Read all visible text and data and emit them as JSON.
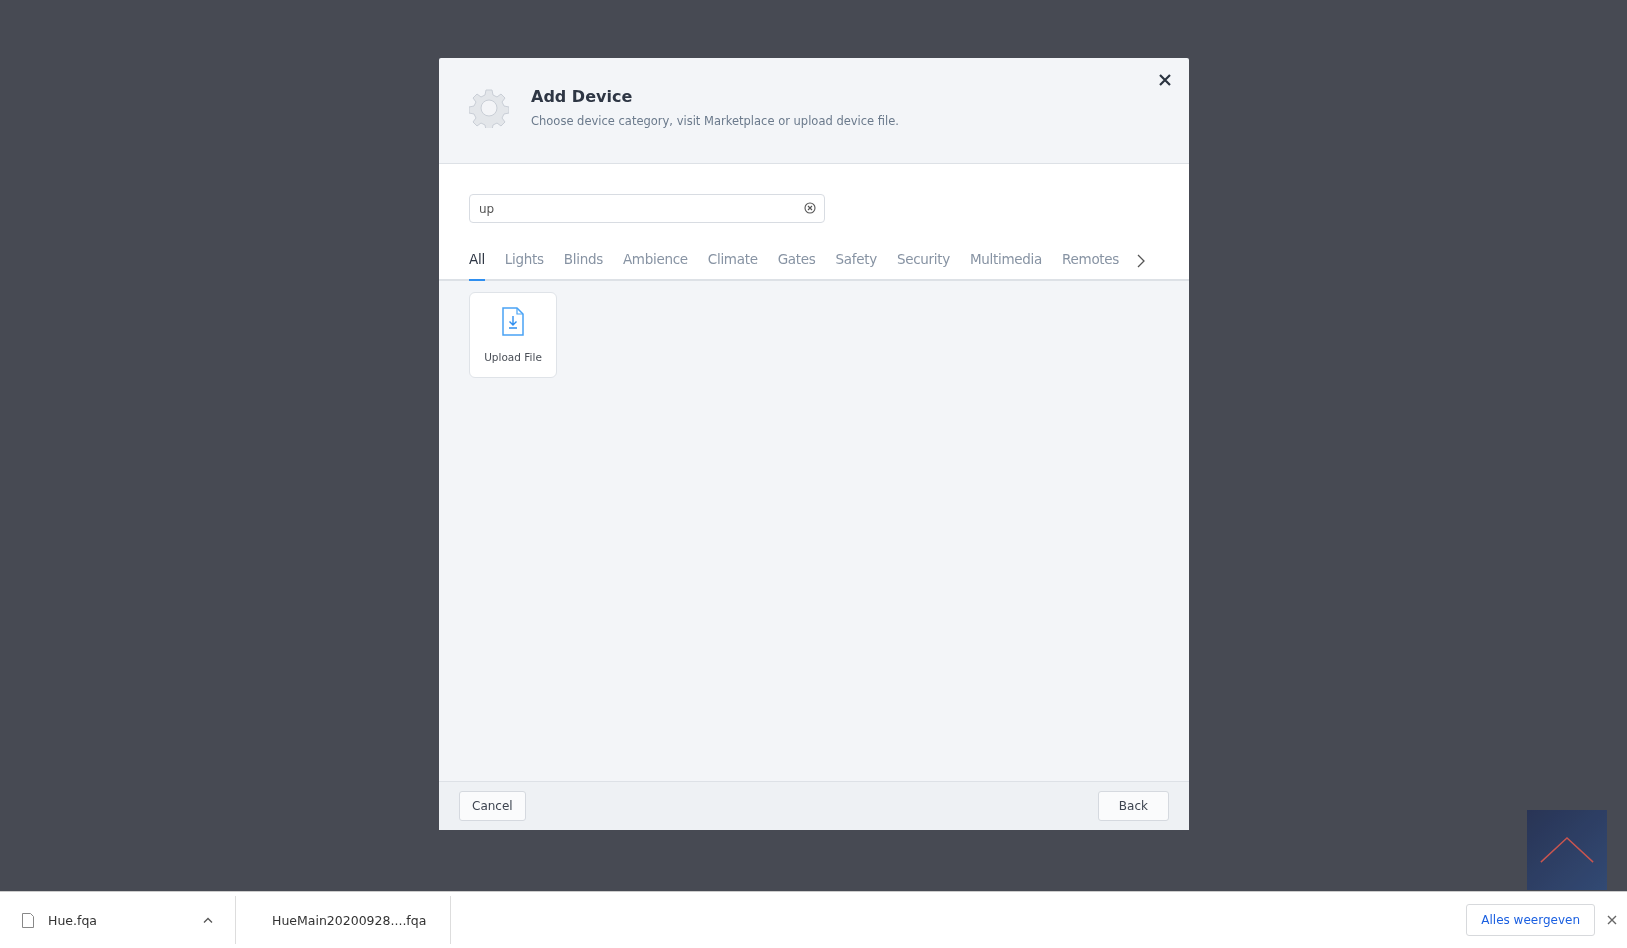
{
  "dialog": {
    "title": "Add Device",
    "subtitle": "Choose device category, visit Marketplace or upload device file.",
    "search": {
      "value": "up"
    },
    "tabs": [
      {
        "label": "All",
        "selected": true
      },
      {
        "label": "Lights",
        "selected": false
      },
      {
        "label": "Blinds",
        "selected": false
      },
      {
        "label": "Ambience",
        "selected": false
      },
      {
        "label": "Climate",
        "selected": false
      },
      {
        "label": "Gates",
        "selected": false
      },
      {
        "label": "Safety",
        "selected": false
      },
      {
        "label": "Security",
        "selected": false
      },
      {
        "label": "Multimedia",
        "selected": false
      },
      {
        "label": "Remotes",
        "selected": false
      }
    ],
    "tiles": [
      {
        "label": "Upload File"
      }
    ],
    "buttons": {
      "cancel": "Cancel",
      "back": "Back"
    }
  },
  "downloads": {
    "items": [
      {
        "name": "Hue.fqa"
      },
      {
        "name": "HueMain20200928....fqa"
      }
    ],
    "show_all": "Alles weergeven"
  }
}
